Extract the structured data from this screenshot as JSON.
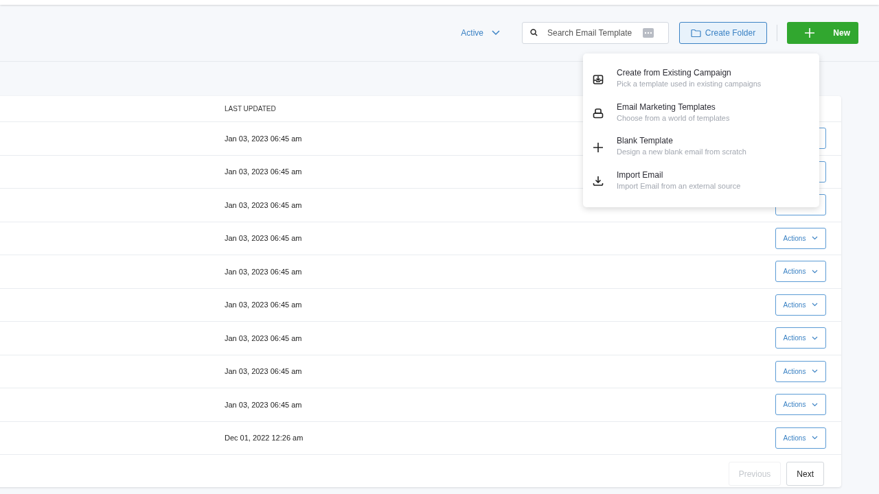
{
  "toolbar": {
    "status_filter": "Active",
    "search": {
      "placeholder": "Search Email Template"
    },
    "create_folder": "Create Folder",
    "new_button": "New"
  },
  "new_menu": [
    {
      "kind": "campaign",
      "title": "Create from Existing Campaign",
      "subtitle": "Pick a template used in existing campaigns"
    },
    {
      "kind": "marketing",
      "title": "Email Marketing Templates",
      "subtitle": "Choose from a world of templates"
    },
    {
      "kind": "blank",
      "title": "Blank Template",
      "subtitle": "Design a new blank email from scratch"
    },
    {
      "kind": "import",
      "title": "Import Email",
      "subtitle": "Import Email from an external source"
    }
  ],
  "table": {
    "columns": [
      "LAST UPDATED"
    ],
    "rows": [
      {
        "last_updated": "Jan 03, 2023 06:45 am"
      },
      {
        "last_updated": "Jan 03, 2023 06:45 am"
      },
      {
        "last_updated": "Jan 03, 2023 06:45 am"
      },
      {
        "last_updated": "Jan 03, 2023 06:45 am",
        "actions": "Actions"
      },
      {
        "last_updated": "Jan 03, 2023 06:45 am",
        "actions": "Actions"
      },
      {
        "last_updated": "Jan 03, 2023 06:45 am",
        "actions": "Actions"
      },
      {
        "last_updated": "Jan 03, 2023 06:45 am",
        "actions": "Actions"
      },
      {
        "last_updated": "Jan 03, 2023 06:45 am",
        "actions": "Actions"
      },
      {
        "last_updated": "Jan 03, 2023 06:45 am",
        "actions": "Actions"
      },
      {
        "last_updated": "Dec 01, 2022 12:26 am",
        "actions": "Actions"
      }
    ]
  },
  "pagination": {
    "previous": {
      "label": "Previous",
      "disabled": true
    },
    "next": {
      "label": "Next",
      "disabled": false
    }
  }
}
